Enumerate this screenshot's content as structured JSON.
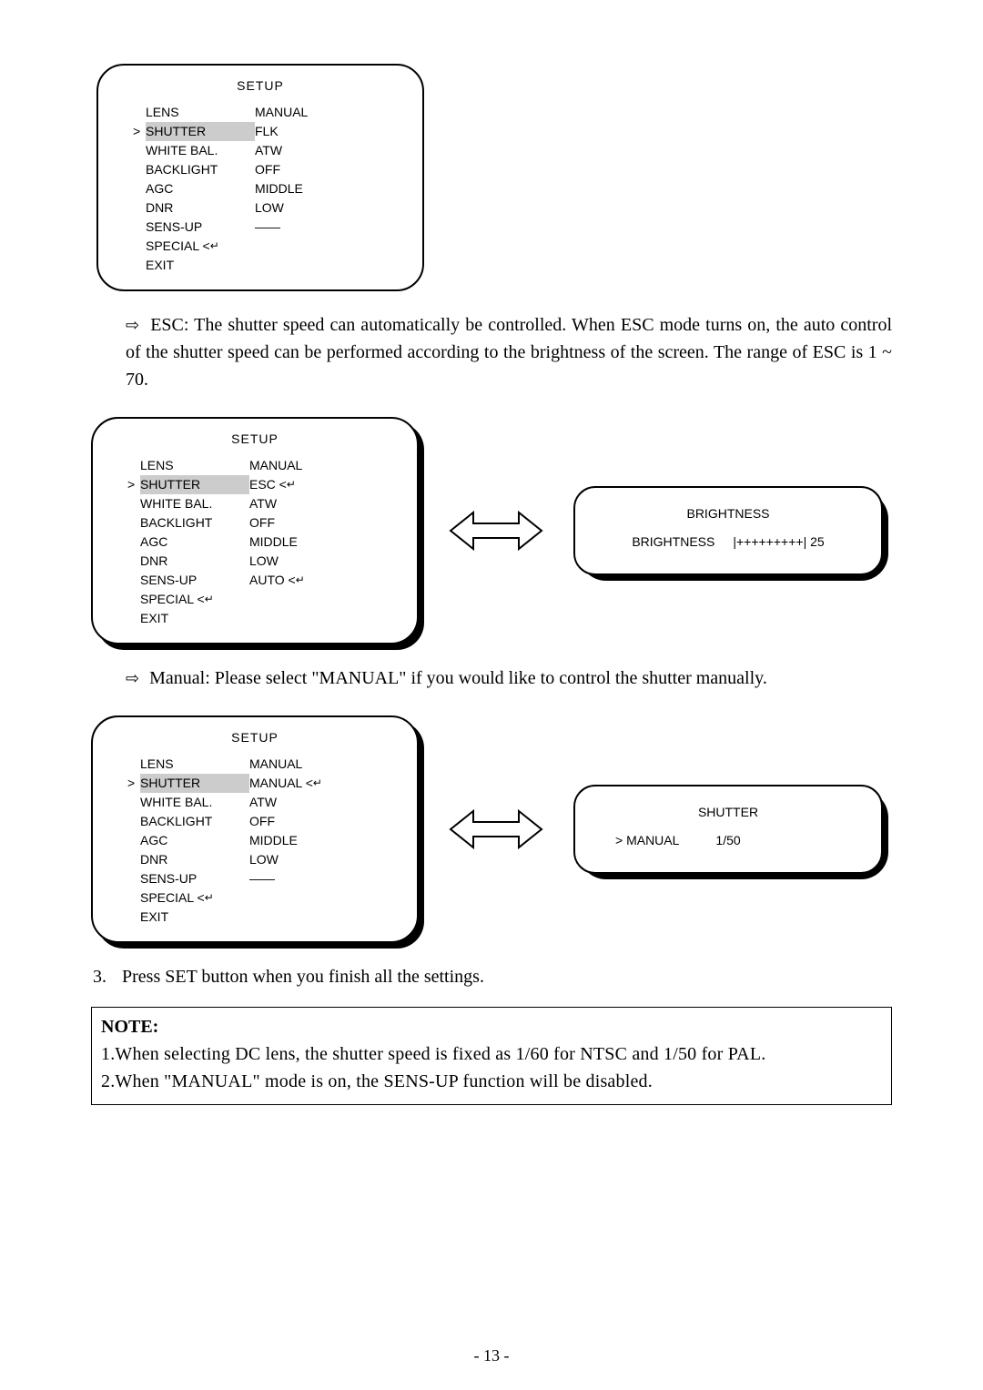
{
  "menu1": {
    "title": "SETUP",
    "rows": [
      {
        "label": "LENS",
        "value": "MANUAL",
        "hl": false
      },
      {
        "label": "SHUTTER",
        "value": "FLK",
        "hl": true
      },
      {
        "label": "WHITE BAL.",
        "value": "ATW",
        "hl": false
      },
      {
        "label": "BACKLIGHT",
        "value": "OFF",
        "hl": false
      },
      {
        "label": "AGC",
        "value": "MIDDLE",
        "hl": false
      },
      {
        "label": "DNR",
        "value": "LOW",
        "hl": false
      },
      {
        "label": "SENS-UP",
        "value": "——",
        "hl": false
      },
      {
        "label": "SPECIAL",
        "value": "",
        "enter": true,
        "hl": false
      },
      {
        "label": "EXIT",
        "value": "",
        "hl": false
      }
    ]
  },
  "esc_para": "ESC: The shutter speed can automatically be controlled. When ESC mode turns on, the auto control of the shutter speed can be performed according to the brightness of the screen. The range of ESC is 1 ~ 70.",
  "menu2": {
    "title": "SETUP",
    "rows": [
      {
        "label": "LENS",
        "value": "MANUAL",
        "hl": false
      },
      {
        "label": "SHUTTER",
        "value": "ESC",
        "value_enter": true,
        "hl": true
      },
      {
        "label": "WHITE BAL.",
        "value": "ATW",
        "hl": false
      },
      {
        "label": "BACKLIGHT",
        "value": "OFF",
        "hl": false
      },
      {
        "label": "AGC",
        "value": "MIDDLE",
        "hl": false
      },
      {
        "label": "DNR",
        "value": "LOW",
        "hl": false
      },
      {
        "label": "SENS-UP",
        "value": "AUTO",
        "value_enter": true,
        "hl": false
      },
      {
        "label": "SPECIAL",
        "value": "",
        "enter": true,
        "hl": false
      },
      {
        "label": "EXIT",
        "value": "",
        "hl": false
      }
    ]
  },
  "brightness_box": {
    "title": "BRIGHTNESS",
    "label": "BRIGHTNESS",
    "bar": "|+++++++++| 25"
  },
  "manual_para": "Manual: Please select \"MANUAL\" if you would like to control the shutter manually.",
  "menu3": {
    "title": "SETUP",
    "rows": [
      {
        "label": "LENS",
        "value": "MANUAL",
        "hl": false
      },
      {
        "label": "SHUTTER",
        "value": "MANUAL",
        "value_enter": true,
        "hl": true
      },
      {
        "label": "WHITE BAL.",
        "value": "ATW",
        "hl": false
      },
      {
        "label": "BACKLIGHT",
        "value": "OFF",
        "hl": false
      },
      {
        "label": "AGC",
        "value": "MIDDLE",
        "hl": false
      },
      {
        "label": "DNR",
        "value": "LOW",
        "hl": false
      },
      {
        "label": "SENS-UP",
        "value": "——",
        "hl": false
      },
      {
        "label": "SPECIAL",
        "value": "",
        "enter": true,
        "hl": false
      },
      {
        "label": "EXIT",
        "value": "",
        "hl": false
      }
    ]
  },
  "shutter_box": {
    "title": "SHUTTER",
    "label": "> MANUAL",
    "value": "1/50"
  },
  "list_item": "Press SET button when you finish all the settings.",
  "note": {
    "heading": "NOTE:",
    "line1": "1.When selecting DC lens, the shutter speed is fixed as 1/60 for NTSC and 1/50 for PAL.",
    "line2": "2.When \"MANUAL\" mode is on, the SENS-UP function will be disabled."
  },
  "page": "- 13 -"
}
